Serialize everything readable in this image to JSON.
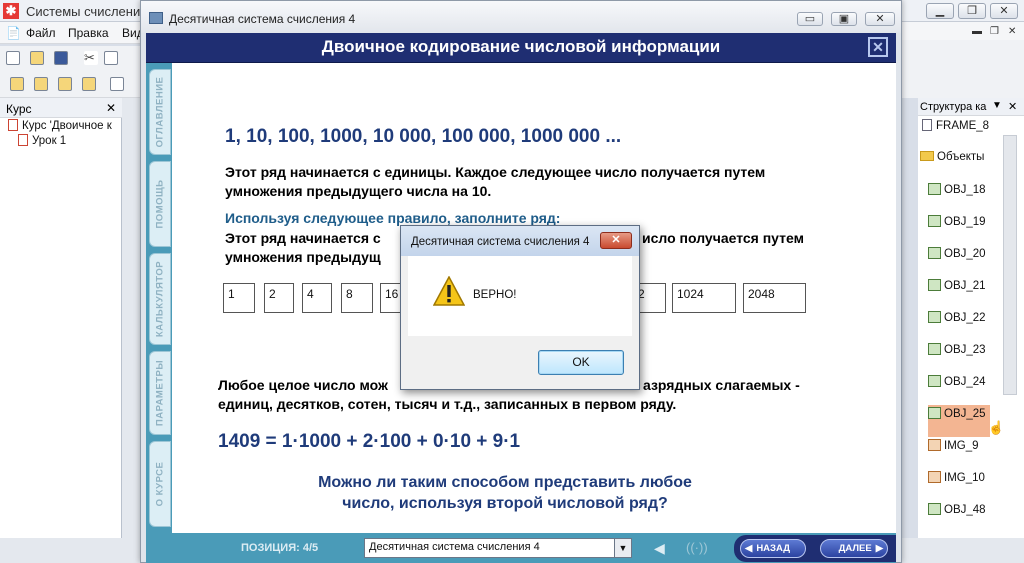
{
  "app": {
    "title": "Системы счисления",
    "menu": [
      "Файл",
      "Правка",
      "Вид"
    ]
  },
  "left_panel": {
    "title": "Курс",
    "close": "✕",
    "items": [
      "Курс 'Двоичное к",
      "Урок 1"
    ]
  },
  "right_panel": {
    "title": "Структура ка",
    "close": "✕",
    "items": [
      "FRAME_8",
      "Объекты",
      "OBJ_18",
      "OBJ_19",
      "OBJ_20",
      "OBJ_21",
      "OBJ_22",
      "OBJ_23",
      "OBJ_24",
      "OBJ_25",
      "IMG_9",
      "IMG_10",
      "OBJ_48"
    ]
  },
  "main_window": {
    "title": "Десятичная система счисления 4"
  },
  "lesson": {
    "header": "Двоичное кодирование числовой информации",
    "side_tabs": [
      "ОГЛАВЛЕНИЕ",
      "ПОМОЩЬ",
      "КАЛЬКУЛЯТОР",
      "ПАРАМЕТРЫ",
      "О КУРСЕ"
    ],
    "sequence": "1, 10, 100, 1000, 10 000, 100 000, 1000 000 ...",
    "para1_line1": "Этот ряд начинается с единицы. Каждое следующее число получается путем",
    "para1_line2": "умножения предыдущего числа на 10.",
    "rule_title": "Используя следующее правило, заполните ряд:",
    "para2_line1a": "Этот ряд начинается с",
    "para2_line1b": "исло получается путем",
    "para2_line2": "умножения предыдущ",
    "cells_left": [
      "1",
      "2",
      "4",
      "8",
      "16"
    ],
    "cells_right": [
      "2",
      "1024",
      "2048"
    ],
    "para3_line1a": "Любое целое число мож",
    "para3_line1b": "азрядных слагаемых -",
    "para3_line2": "единиц, десятков, сотен, тысяч и т.д., записанных в первом ряду.",
    "formula": "1409 = 1·1000 + 2·100 + 0·10 + 9·1",
    "question_line1": "Можно ли таким способом представить любое",
    "question_line2": "число, используя второй числовой ряд?"
  },
  "bottom": {
    "position_label": "ПОЗИЦИЯ: 4/5",
    "selected_page": "Десятичная система счисления 4",
    "back_label": "НАЗАД",
    "next_label": "ДАЛЕЕ"
  },
  "dialog": {
    "title": "Десятичная система счисления 4",
    "message": "ВЕРНО!",
    "ok_label": "OK"
  }
}
